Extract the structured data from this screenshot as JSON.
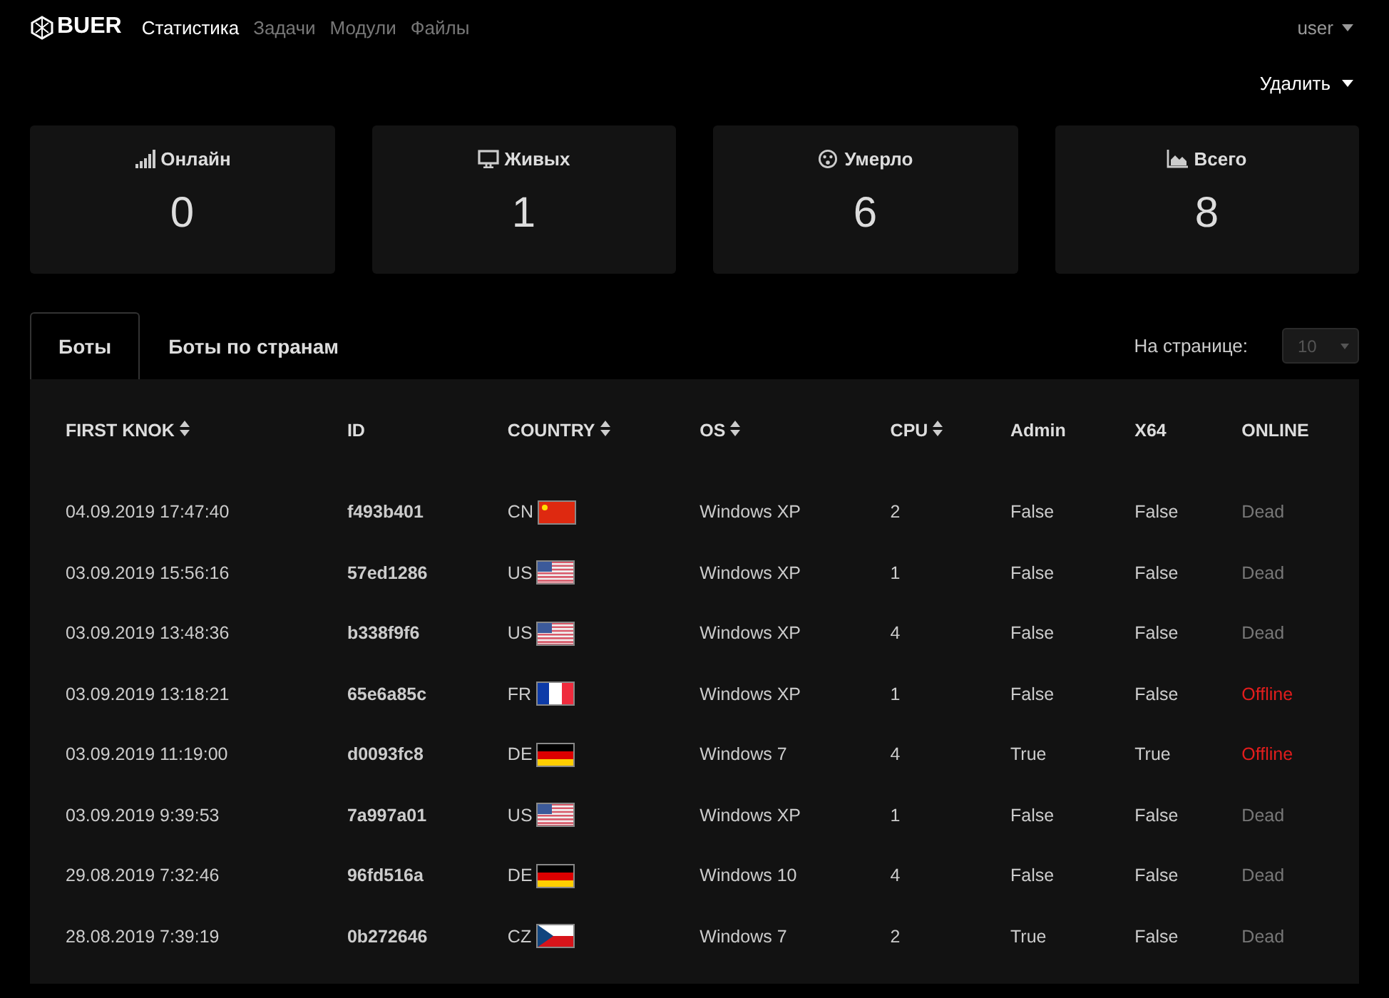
{
  "brand": {
    "name": "BUER"
  },
  "nav": [
    {
      "label": "Статистика",
      "selected": true
    },
    {
      "label": "Задачи",
      "selected": false
    },
    {
      "label": "Модули",
      "selected": false
    },
    {
      "label": "Файлы",
      "selected": false
    }
  ],
  "user_menu": {
    "label": "user"
  },
  "delete_menu": {
    "label": "Удалить"
  },
  "stats": [
    {
      "kind": "signal",
      "label": "Онлайн",
      "value": "0"
    },
    {
      "kind": "monitor",
      "label": "Живых",
      "value": "1"
    },
    {
      "kind": "face",
      "label": "Умерло",
      "value": "6"
    },
    {
      "kind": "chart",
      "label": "Всего",
      "value": "8"
    }
  ],
  "tabs": [
    {
      "label": "Боты",
      "selected": true
    },
    {
      "label": "Боты по странам",
      "selected": false
    }
  ],
  "per_page": {
    "label": "На странице:",
    "value": "10",
    "disabled": true
  },
  "table": {
    "columns": [
      {
        "label": "FIRST KNOK",
        "sortable": true
      },
      {
        "label": "ID",
        "sortable": false
      },
      {
        "label": "COUNTRY",
        "sortable": true
      },
      {
        "label": "OS",
        "sortable": true
      },
      {
        "label": "CPU",
        "sortable": true
      },
      {
        "label": "Admin",
        "sortable": false
      },
      {
        "label": "X64",
        "sortable": false
      },
      {
        "label": "ONLINE",
        "sortable": false
      }
    ],
    "rows": [
      {
        "first_knok": "04.09.2019 17:47:40",
        "id": "f493b401",
        "country": "CN",
        "kind": "cn",
        "os": "Windows XP",
        "cpu": "2",
        "admin": "False",
        "x64": "False",
        "online": "Dead",
        "color": "#777777"
      },
      {
        "first_knok": "03.09.2019 15:56:16",
        "id": "57ed1286",
        "country": "US",
        "kind": "us",
        "os": "Windows XP",
        "cpu": "1",
        "admin": "False",
        "x64": "False",
        "online": "Dead",
        "color": "#777777"
      },
      {
        "first_knok": "03.09.2019 13:48:36",
        "id": "b338f9f6",
        "country": "US",
        "kind": "us",
        "os": "Windows XP",
        "cpu": "4",
        "admin": "False",
        "x64": "False",
        "online": "Dead",
        "color": "#777777"
      },
      {
        "first_knok": "03.09.2019 13:18:21",
        "id": "65e6a85c",
        "country": "FR",
        "kind": "fr",
        "os": "Windows XP",
        "cpu": "1",
        "admin": "False",
        "x64": "False",
        "online": "Offline",
        "color": "#e21d1d"
      },
      {
        "first_knok": "03.09.2019 11:19:00",
        "id": "d0093fc8",
        "country": "DE",
        "kind": "de",
        "os": "Windows 7",
        "cpu": "4",
        "admin": "True",
        "x64": "True",
        "online": "Offline",
        "color": "#e21d1d"
      },
      {
        "first_knok": "03.09.2019 9:39:53",
        "id": "7a997a01",
        "country": "US",
        "kind": "us",
        "os": "Windows XP",
        "cpu": "1",
        "admin": "False",
        "x64": "False",
        "online": "Dead",
        "color": "#777777"
      },
      {
        "first_knok": "29.08.2019 7:32:46",
        "id": "96fd516a",
        "country": "DE",
        "kind": "de",
        "os": "Windows 10",
        "cpu": "4",
        "admin": "False",
        "x64": "False",
        "online": "Dead",
        "color": "#777777"
      },
      {
        "first_knok": "28.08.2019 7:39:19",
        "id": "0b272646",
        "country": "CZ",
        "kind": "cz",
        "os": "Windows 7",
        "cpu": "2",
        "admin": "True",
        "x64": "False",
        "online": "Dead",
        "color": "#777777"
      }
    ]
  }
}
